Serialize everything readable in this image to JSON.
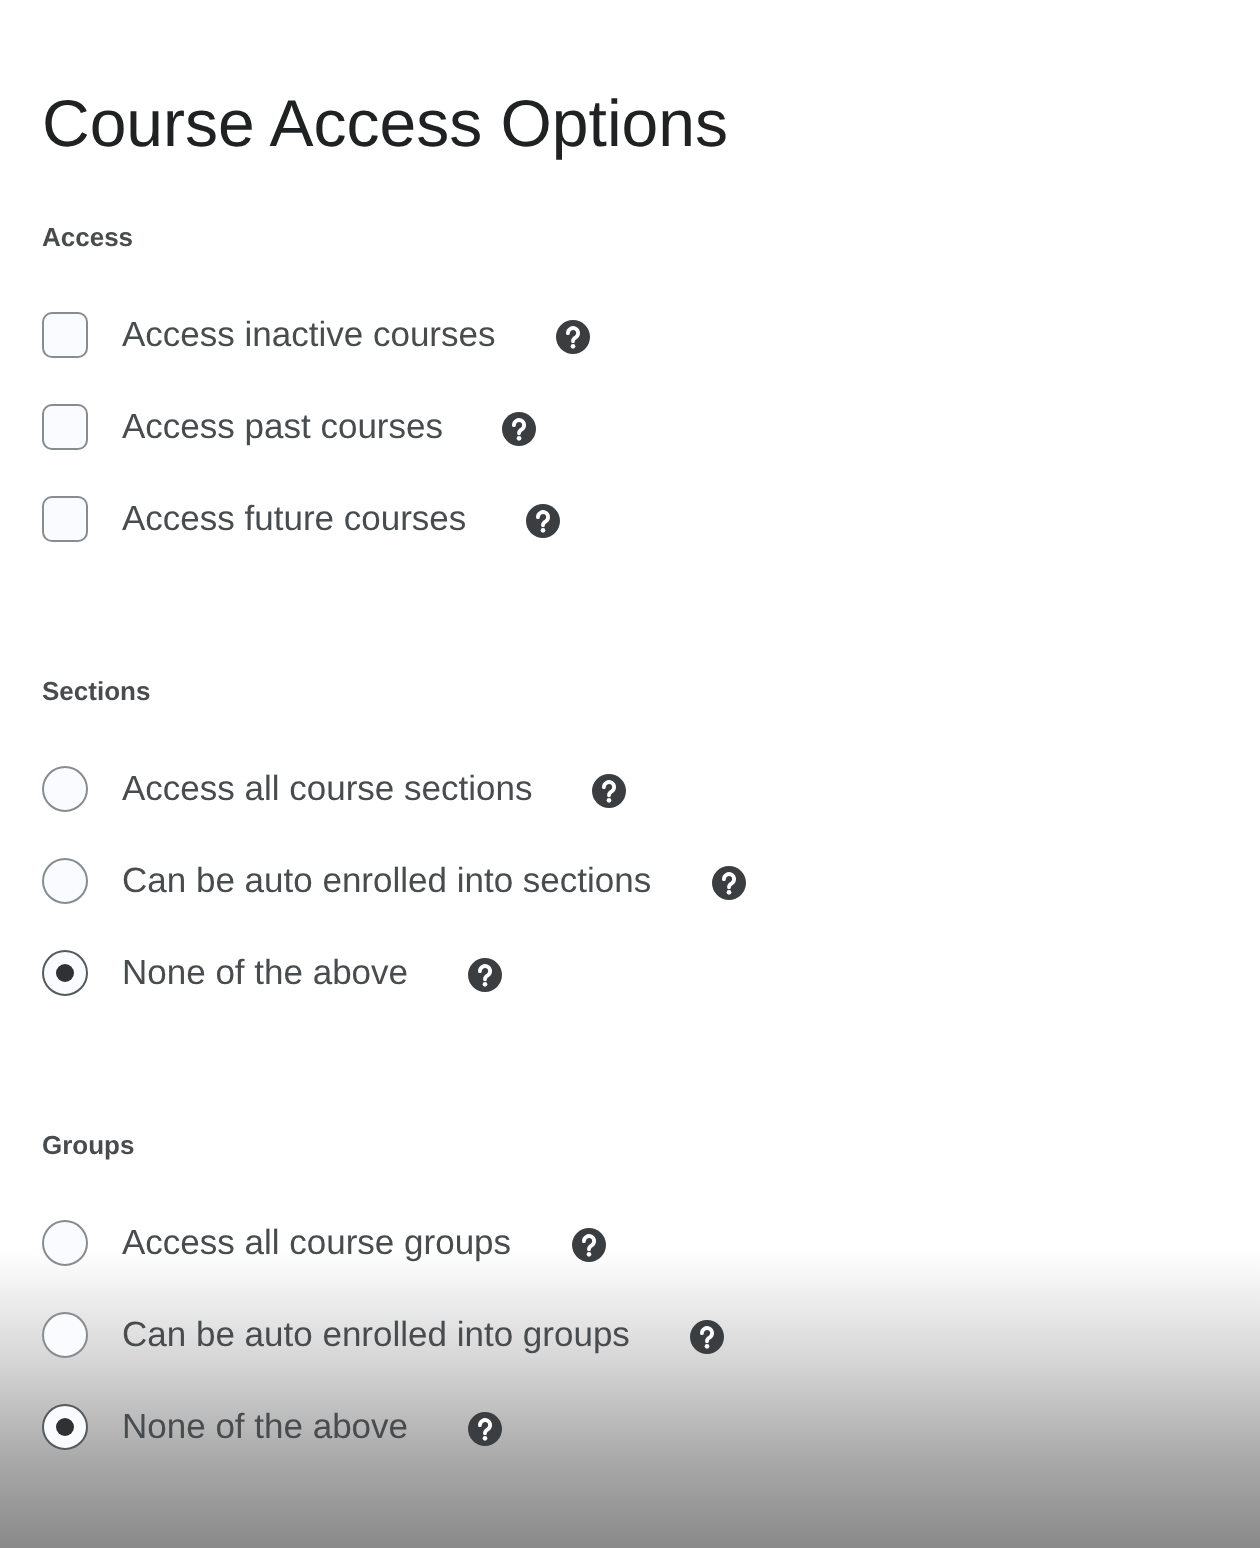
{
  "title": "Course Access Options",
  "sections": [
    {
      "label": "Access",
      "kind": "checkbox",
      "options": [
        {
          "label": "Access inactive courses",
          "checked": false
        },
        {
          "label": "Access past courses",
          "checked": false
        },
        {
          "label": "Access future courses",
          "checked": false
        }
      ]
    },
    {
      "label": "Sections",
      "kind": "radio",
      "options": [
        {
          "label": "Access all course sections",
          "selected": false
        },
        {
          "label": "Can be auto enrolled into sections",
          "selected": false
        },
        {
          "label": "None of the above",
          "selected": true
        }
      ]
    },
    {
      "label": "Groups",
      "kind": "radio",
      "options": [
        {
          "label": "Access all course groups",
          "selected": false
        },
        {
          "label": "Can be auto enrolled into groups",
          "selected": false
        },
        {
          "label": "None of the above",
          "selected": true
        }
      ]
    }
  ]
}
